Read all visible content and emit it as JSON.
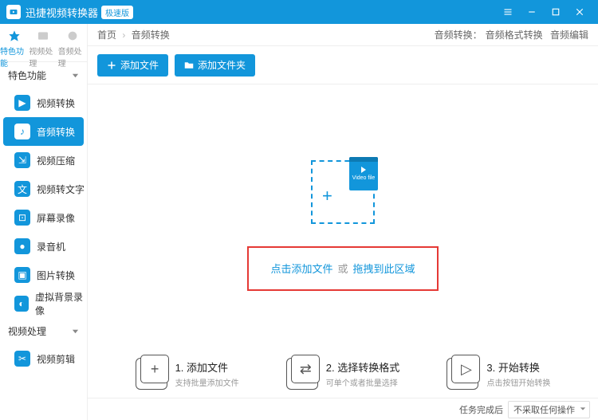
{
  "titlebar": {
    "app_name": "迅捷视频转换器",
    "badge": "极速版"
  },
  "tabs": {
    "t0": "特色功能",
    "t1": "视频处理",
    "t2": "音频处理"
  },
  "sections": {
    "features": "特色功能",
    "video_proc": "视频处理"
  },
  "nav": {
    "n0": "视频转换",
    "n1": "音频转换",
    "n2": "视频压缩",
    "n3": "视频转文字",
    "n4": "屏幕录像",
    "n5": "录音机",
    "n6": "图片转换",
    "n7": "虚拟背景录像",
    "n8": "视频剪辑"
  },
  "breadcrumb": {
    "home": "首页",
    "current": "音频转换"
  },
  "sublinks": {
    "prefix": "音频转换：",
    "a": "音频格式转换",
    "b": "音频编辑"
  },
  "toolbar": {
    "add_file": "添加文件",
    "add_folder": "添加文件夹"
  },
  "dropzone": {
    "file_caption": "Video file"
  },
  "highlight": {
    "click_add": "点击添加文件",
    "or": "或",
    "drag": "拖拽到此区域"
  },
  "steps": {
    "s1t": "1. 添加文件",
    "s1s": "支持批量添加文件",
    "s2t": "2. 选择转换格式",
    "s2s": "可单个或者批量选择",
    "s3t": "3. 开始转换",
    "s3s": "点击按钮开始转换"
  },
  "footer": {
    "label": "任务完成后",
    "option": "不采取任何操作"
  }
}
